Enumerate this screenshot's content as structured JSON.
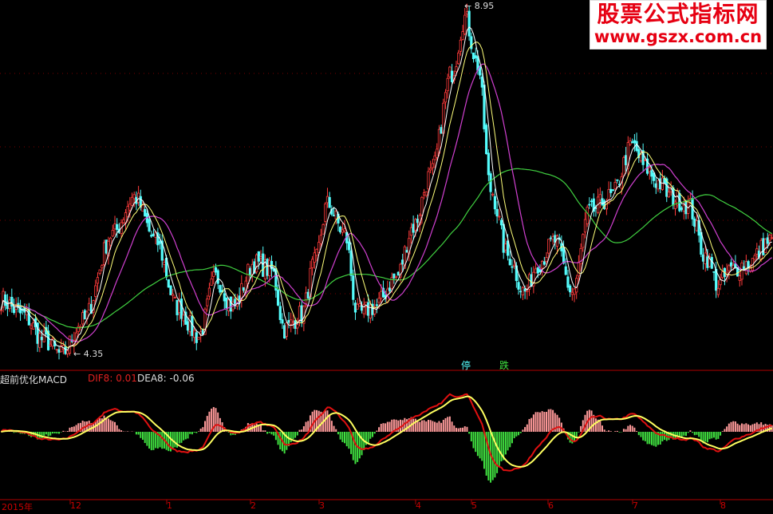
{
  "watermark": {
    "line1": "股票公式指标网",
    "line2": "www.gszx.com.cn"
  },
  "macd_header": {
    "title": "超前优化MACD",
    "dif_label": "DIF8:",
    "dif_value": "0.01",
    "dea_label": "DEA8:",
    "dea_value": "-0.06"
  },
  "markers": {
    "low_label": "4.35",
    "high_label": "8.95",
    "stop": "停",
    "down": "跌"
  },
  "x_ticks": [
    "2015年",
    "12",
    "1",
    "2",
    "3",
    "4",
    "5",
    "6",
    "7",
    "8"
  ],
  "colors": {
    "up": "#ff3b3b",
    "down": "#54fcfc",
    "ma5": "#ffffff",
    "ma10": "#ffff7a",
    "ma20": "#d040d0",
    "ma60": "#40d040",
    "dif": "#e01010",
    "dea_up": "#ffff60",
    "dea_down": "#3070ff",
    "hist_pos": "#ff9a9a",
    "hist_neg": "#40e040",
    "grid": "#7a0000"
  },
  "chart_data": [
    {
      "type": "candlestick",
      "title": "",
      "x_ticks": [
        "2015年",
        "12",
        "1",
        "2",
        "3",
        "4",
        "5",
        "6",
        "7",
        "8"
      ],
      "ylim": [
        4.2,
        9.1
      ],
      "anchors": [
        [
          0,
          5.1
        ],
        [
          10,
          4.9
        ],
        [
          20,
          4.55
        ],
        [
          28,
          4.35
        ],
        [
          38,
          4.8
        ],
        [
          52,
          6.0
        ],
        [
          62,
          6.5
        ],
        [
          72,
          5.9
        ],
        [
          82,
          5.0
        ],
        [
          92,
          4.6
        ],
        [
          100,
          5.4
        ],
        [
          108,
          5.0
        ],
        [
          118,
          5.6
        ],
        [
          126,
          5.5
        ],
        [
          132,
          4.7
        ],
        [
          140,
          4.9
        ],
        [
          146,
          5.6
        ],
        [
          152,
          6.4
        ],
        [
          160,
          6.0
        ],
        [
          166,
          4.9
        ],
        [
          174,
          5.0
        ],
        [
          184,
          5.4
        ],
        [
          192,
          6.1
        ],
        [
          200,
          6.8
        ],
        [
          210,
          8.2
        ],
        [
          216,
          8.95
        ],
        [
          222,
          8.3
        ],
        [
          228,
          6.6
        ],
        [
          236,
          5.7
        ],
        [
          244,
          5.2
        ],
        [
          250,
          5.6
        ],
        [
          258,
          5.9
        ],
        [
          266,
          5.2
        ],
        [
          274,
          6.3
        ],
        [
          284,
          6.5
        ],
        [
          294,
          7.2
        ],
        [
          300,
          6.9
        ],
        [
          306,
          6.7
        ],
        [
          312,
          6.5
        ],
        [
          320,
          6.4
        ],
        [
          328,
          5.7
        ],
        [
          334,
          5.3
        ],
        [
          340,
          5.5
        ],
        [
          348,
          5.6
        ],
        [
          358,
          5.9
        ]
      ],
      "low_label_value": 4.35,
      "high_label_value": 8.95
    },
    {
      "type": "line",
      "title": "超前优化MACD",
      "series": [
        {
          "name": "DIF8",
          "last": 0.01
        },
        {
          "name": "DEA8",
          "last": -0.06
        }
      ],
      "ylim": [
        -0.9,
        0.7
      ]
    }
  ]
}
